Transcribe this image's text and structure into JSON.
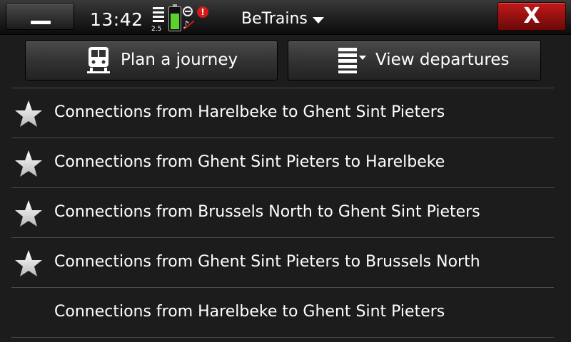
{
  "status_bar": {
    "time": "13:42",
    "network_label": "2.5",
    "app_title": "BeTrains",
    "close_label": "X"
  },
  "toolbar": {
    "plan_label": "Plan a journey",
    "departures_label": "View departures"
  },
  "favorites": [
    {
      "text": "Connections from Harelbeke to Ghent Sint Pieters",
      "starred": true
    },
    {
      "text": "Connections from Ghent Sint Pieters to Harelbeke",
      "starred": true
    },
    {
      "text": "Connections from Brussels North to Ghent Sint Pieters",
      "starred": true
    },
    {
      "text": "Connections from Ghent Sint Pieters to Brussels North",
      "starred": true
    },
    {
      "text": "Connections from Harelbeke to Ghent Sint Pieters",
      "starred": false
    }
  ],
  "colors": {
    "background": "#1c1c1c",
    "close_button": "#a01010",
    "battery": "#5bd22b",
    "alert": "#d31b1b"
  }
}
